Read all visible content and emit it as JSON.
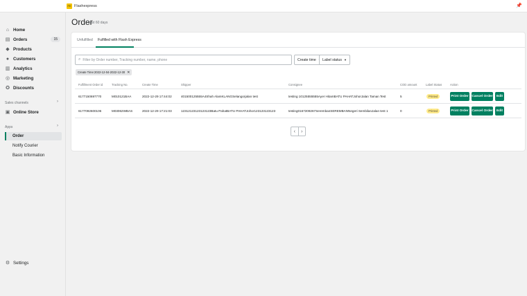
{
  "app": {
    "logo_text": "FE",
    "name": "Flashexpress"
  },
  "sidebar": {
    "items": [
      {
        "label": "Home",
        "icon": "⌂"
      },
      {
        "label": "Orders",
        "icon": "▤",
        "badge": "15"
      },
      {
        "label": "Products",
        "icon": "◆"
      },
      {
        "label": "Customers",
        "icon": "●"
      },
      {
        "label": "Analytics",
        "icon": "▥"
      },
      {
        "label": "Marketing",
        "icon": "◎"
      },
      {
        "label": "Discounts",
        "icon": "✪"
      }
    ],
    "sales_channels_label": "Sales channels",
    "online_store_label": "Online Store",
    "apps_label": "Apps",
    "app_items": [
      "Order",
      "Notify Courier",
      "Basic Information"
    ],
    "settings_label": "Settings"
  },
  "page": {
    "title": "Order",
    "subtitle": "Last 60 days"
  },
  "tabs": [
    "Unfulfilled",
    "Fulfilled with Flash Express"
  ],
  "search": {
    "placeholder": "Filter by Order number, Tracking number, name, phone",
    "value": ""
  },
  "filters": {
    "create_time": "Create time",
    "label_status": "Label status"
  },
  "chip": "Create Time:2022-12-04-2022-12-30",
  "table": {
    "headers": [
      "Fulfillment Order id",
      "Tracking No.",
      "Create Time",
      "Shipper",
      "Consignee",
      "COD amount",
      "Label Status",
      "Action"
    ],
    "rows": [
      {
        "id": "6177150697770",
        "tracking": "M010121BAA",
        "time": "2022-12-29 17:44:02",
        "shipper": "401500125555A4Shah AlamKLANGSelangorjalan test",
        "consignee": "testing 10125555555Ayer HitamBATU PAHATJohorJalan Taman Test",
        "cod": "5",
        "status": "Printed"
      },
      {
        "id": "6177092600106",
        "tracking": "M03062WBAS",
        "time": "2022-12-29 17:21:03",
        "shipper": "12312123123123123Batu PahatBATU PAHATJohor123123123123",
        "consignee": "testing0167209267SerembanSEREMBANNegeri SembilanJalan test 1",
        "cod": "0",
        "status": "Printed"
      }
    ],
    "actions": {
      "print": "Print Order",
      "cancel": "Cancel Order",
      "edit": "Edit"
    }
  },
  "pager": {
    "prev": "‹",
    "next": "›"
  }
}
